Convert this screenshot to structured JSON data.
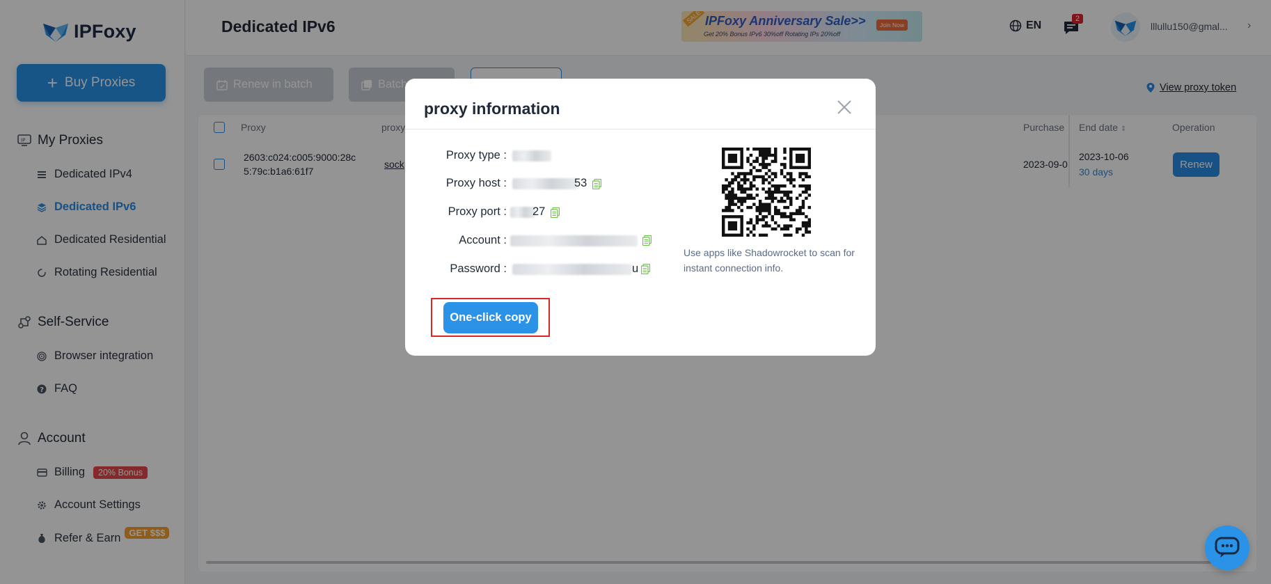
{
  "brand": {
    "name": "IPFoxy"
  },
  "sidebar": {
    "buy_label": "Buy Proxies",
    "sections": [
      {
        "title": "My Proxies",
        "icon": "ip-icon"
      },
      {
        "title": "Self-Service",
        "icon": "self-service-icon"
      },
      {
        "title": "Account",
        "icon": "user-icon"
      }
    ],
    "items": [
      {
        "label": "Dedicated IPv4",
        "icon": "list-icon"
      },
      {
        "label": "Dedicated IPv6",
        "icon": "layers-icon",
        "active": true
      },
      {
        "label": "Dedicated Residential",
        "icon": "home-icon"
      },
      {
        "label": "Rotating Residential",
        "icon": "rotate-icon"
      },
      {
        "label": "Browser integration",
        "icon": "fingerprint-icon"
      },
      {
        "label": "FAQ",
        "icon": "question-icon"
      },
      {
        "label": "Billing",
        "icon": "card-icon",
        "badge": "20% Bonus"
      },
      {
        "label": "Account Settings",
        "icon": "gear-icon"
      },
      {
        "label": "Refer & Earn",
        "icon": "money-bag-icon",
        "badge": "GET $$$"
      }
    ]
  },
  "header": {
    "title": "Dedicated IPv6",
    "banner": {
      "tag": "SALE",
      "title": "IPFoxy Anniversary Sale>>",
      "subtitle": "Get 20% Bonus    IPv6 30%off    Rotating IPs 20%off",
      "cta": "Join Now"
    },
    "language": "EN",
    "message_count": "2",
    "user_email": "lllullu150@gmal..."
  },
  "toolbar": {
    "renew_batch": "Renew in batch",
    "batch_label": "Batch",
    "view_token": "View proxy token"
  },
  "table": {
    "headers": {
      "proxy": "Proxy",
      "proxy_type": "proxy",
      "purchase": "Purchase",
      "end_date": "End date",
      "operation": "Operation"
    },
    "row": {
      "proxy_line1": "2603:c024:c005:9000:28c",
      "proxy_line2": "5:79c:b1a6:61f7",
      "proxy_type": "sock",
      "purchase": "2023-09-0",
      "end_date": "2023-10-06",
      "remaining": "30 days",
      "renew": "Renew"
    }
  },
  "modal": {
    "title": "proxy information",
    "fields": {
      "type_label": "Proxy type :",
      "host_label": "Proxy host :",
      "host_suffix": "53",
      "port_label": "Proxy port :",
      "port_suffix": "27",
      "account_label": "Account :",
      "password_label": "Password :",
      "password_suffix": "u"
    },
    "qr_hint": "Use apps like Shadowrocket to scan for instant connection info.",
    "copy_button": "One-click copy"
  },
  "colors": {
    "accent": "#2a93e8",
    "highlight": "#e0232b",
    "badge_red": "#e5484d",
    "badge_orange": "#f5a131"
  }
}
